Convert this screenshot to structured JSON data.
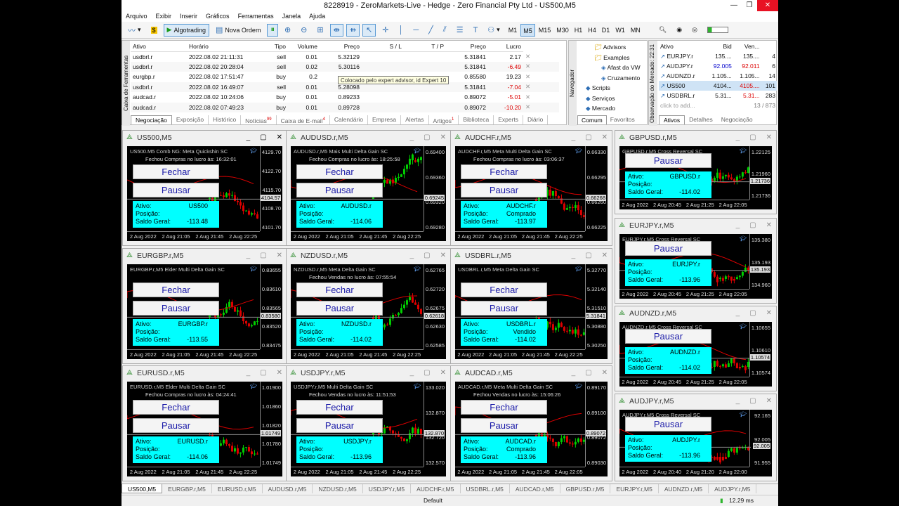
{
  "title": "8228919 - ZeroMarkets-Live - Hedge - Zero Financial Pty Ltd - US500,M5",
  "menu": [
    "Arquivo",
    "Exibir",
    "Inserir",
    "Gráficos",
    "Ferramentas",
    "Janela",
    "Ajuda"
  ],
  "toolbar": {
    "algo_label": "Algotrading",
    "new_order_label": "Nova Ordem",
    "timeframes": [
      "M1",
      "M5",
      "M15",
      "M30",
      "H1",
      "H4",
      "D1",
      "W1",
      "MN"
    ],
    "active_tf": "M5"
  },
  "toolbox": {
    "side_label": "Caixa de Ferramentas",
    "headers": [
      "Ativo",
      "Horário",
      "Tipo",
      "Volume",
      "Preço",
      "S / L",
      "T / P",
      "Preço",
      "Lucro"
    ],
    "rows": [
      {
        "symbol": "usdbrl.r",
        "time": "2022.08.02 21:11:31",
        "type": "sell",
        "volume": "0.01",
        "price": "5.32129",
        "sl": "",
        "tp": "",
        "cur": "5.31841",
        "profit": "2.17",
        "neg": false
      },
      {
        "symbol": "usdbrl.r",
        "time": "2022.08.02 20:28:04",
        "type": "sell",
        "volume": "0.02",
        "price": "5.30116",
        "sl": "",
        "tp": "",
        "cur": "5.31841",
        "profit": "-6.49",
        "neg": true
      },
      {
        "symbol": "eurgbp.r",
        "time": "2022.08.02 17:51:47",
        "type": "buy",
        "volume": "0.2",
        "price": "",
        "sl": "",
        "tp": "",
        "cur": "0.85580",
        "profit": "19.23",
        "neg": false
      },
      {
        "symbol": "usdbrl.r",
        "time": "2022.08.02 16:49:07",
        "type": "sell",
        "volume": "0.01",
        "price": "5.28098",
        "sl": "",
        "tp": "",
        "cur": "5.31841",
        "profit": "-7.04",
        "neg": true
      },
      {
        "symbol": "audcad.r",
        "time": "2022.08.02 10:24:06",
        "type": "buy",
        "volume": "0.01",
        "price": "0.89233",
        "sl": "",
        "tp": "",
        "cur": "0.89072",
        "profit": "-5.01",
        "neg": true
      },
      {
        "symbol": "audcad.r",
        "time": "2022.08.02 07:49:23",
        "type": "buy",
        "volume": "0.01",
        "price": "0.89728",
        "sl": "",
        "tp": "",
        "cur": "0.89072",
        "profit": "-10.20",
        "neg": true
      }
    ],
    "tooltip": "Colocado pelo expert advisor, id Expert 10",
    "tabs": [
      "Negociação",
      "Exposição",
      "Histórico",
      "Notícias",
      "Caixa de E-mail",
      "Calendário",
      "Empresa",
      "Alertas",
      "Artigos",
      "Biblioteca",
      "Experts",
      "Diário"
    ],
    "tab_badges": {
      "Notícias": "99",
      "Caixa de E-mail": "4",
      "Artigos": "1"
    }
  },
  "navigator": {
    "side_label": "Navegador",
    "items": [
      "Advisors",
      "Examples",
      "Afast da VW",
      "Cruzamento",
      "Scripts",
      "Serviços",
      "Mercado"
    ],
    "tabs": [
      "Comum",
      "Favoritos"
    ]
  },
  "market_watch": {
    "side_label": "Observação do Mercado: 22:31",
    "headers": [
      "Ativo",
      "Bid",
      "Ven...",
      ""
    ],
    "rows": [
      {
        "symbol": "EURJPY.r",
        "bid": "135....",
        "ask": "135....",
        "spread": "4",
        "bidc": "",
        "askc": ""
      },
      {
        "symbol": "AUDJPY.r",
        "bid": "92.005",
        "ask": "92.011",
        "spread": "6",
        "bidc": "blue",
        "askc": "red"
      },
      {
        "symbol": "AUDNZD.r",
        "bid": "1.105...",
        "ask": "1.105...",
        "spread": "14",
        "bidc": "",
        "askc": ""
      },
      {
        "symbol": "US500",
        "bid": "4104...",
        "ask": "4105....",
        "spread": "101",
        "bidc": "",
        "askc": "red",
        "sel": true
      },
      {
        "symbol": "USDBRL.r",
        "bid": "5.31...",
        "ask": "5.31...",
        "spread": "283",
        "bidc": "",
        "askc": "red"
      }
    ],
    "click_to_add": "click to add...",
    "count": "13 / 873",
    "tabs": [
      "Ativos",
      "Detalhes",
      "Negociação"
    ]
  },
  "labels": {
    "close": "Fechar",
    "pause": "Pausar",
    "asset": "Ativo:",
    "position": "Posição:",
    "balance": "Saldo Geral:"
  },
  "charts": [
    {
      "title": "US500,M5",
      "symbol": "US500",
      "position": "",
      "balance": "-113.48",
      "hdr1": "US500.M5 Comb NG: Meta Quickshin SC",
      "hdr2": "Fechou Compras no lucro às: 16:32:01",
      "prices": [
        "4129.70",
        "4122.70",
        "4115.70",
        "4108.70",
        "4101.70"
      ],
      "cur": "4104.57",
      "times": [
        "2 Aug 2022",
        "2 Aug 21:05",
        "2 Aug 21:45",
        "2 Aug 22:25"
      ],
      "showClose": true
    },
    {
      "title": "AUDUSD.r,M5",
      "symbol": "AUDUSD.r",
      "position": "",
      "balance": "-114.06",
      "hdr1": "AUDUSD.r,M5 Mais Multi Delta Gain SC",
      "hdr2": "Fechou Compras no lucro às: 18:25:58",
      "prices": [
        "0.69400",
        "0.69360",
        "0.69320",
        "0.69280"
      ],
      "cur": "0.69245",
      "times": [
        "2 Aug 2022",
        "2 Aug 21:05",
        "2 Aug 21:45",
        "2 Aug 22:25"
      ],
      "showClose": true
    },
    {
      "title": "AUDCHF.r,M5",
      "symbol": "AUDCHF.r",
      "position": "Comprado",
      "balance": "-113.97",
      "hdr1": "AUDCHF.r,M5 Meta Multi Delta Gain SC",
      "hdr2": "Fechou Compras no lucro às: 03:06:37",
      "prices": [
        "0.66330",
        "0.66295",
        "0.66260",
        "0.66225"
      ],
      "cur": "0.66268",
      "times": [
        "2 Aug 2022",
        "2 Aug 21:05",
        "2 Aug 21:45",
        "2 Aug 22:25"
      ],
      "showClose": true
    },
    {
      "title": "GBPUSD.r,M5",
      "symbol": "GBPUSD.r",
      "position": "",
      "balance": "-114.02",
      "hdr1": "GBPUSD.r,M5 Cross Reversal SC",
      "hdr2": "",
      "prices": [
        "1.22125",
        "1.21960",
        "1.21736"
      ],
      "cur": "1.21736",
      "times": [
        "2 Aug 2022",
        "2 Aug 20:45",
        "2 Aug 21:25",
        "2 Aug 22:05"
      ],
      "showClose": false
    },
    {
      "title": "EURGBP.r,M5",
      "symbol": "EURGBP.r",
      "position": "",
      "balance": "-113.55",
      "hdr1": "EURGBP.r,M5 Elder Multi Delta Gain SC",
      "hdr2": "",
      "prices": [
        "0.83655",
        "0.83610",
        "0.83565",
        "0.83520",
        "0.83475"
      ],
      "cur": "0.83580",
      "times": [
        "2 Aug 2022",
        "2 Aug 21:05",
        "2 Aug 21:45",
        "2 Aug 22:25"
      ],
      "showClose": true
    },
    {
      "title": "NZDUSD.r,M5",
      "symbol": "NZDUSD.r",
      "position": "",
      "balance": "-114.02",
      "hdr1": "NZDUSD.r,M5 Meta Delta Gain SC",
      "hdr2": "Fechou Vendas no lucro às: 07:55:54",
      "prices": [
        "0.62765",
        "0.62720",
        "0.62675",
        "0.62630",
        "0.62585"
      ],
      "cur": "0.62618",
      "times": [
        "2 Aug 2022",
        "2 Aug 21:05",
        "2 Aug 21:45",
        "2 Aug 22:25"
      ],
      "showClose": true
    },
    {
      "title": "USDBRL.r,M5",
      "symbol": "USDBRL.r",
      "position": "Vendido",
      "balance": "-114.02",
      "hdr1": "USDBRL.r,M5 Meta Delta Gain SC",
      "hdr2": "",
      "prices": [
        "5.32770",
        "5.32140",
        "5.31510",
        "5.30880",
        "5.30250"
      ],
      "cur": "5.31841",
      "times": [
        "2 Aug 2022",
        "2 Aug 21:05",
        "2 Aug 21:45",
        "2 Aug 22:25"
      ],
      "showClose": true
    },
    {
      "title": "EURJPY.r,M5",
      "symbol": "EURJPY.r",
      "position": "",
      "balance": "-113.96",
      "hdr1": "EURJPY.r,M5 Cross Reversal SC",
      "hdr2": "",
      "prices": [
        "135.380",
        "135.193",
        "134.960"
      ],
      "cur": "135.193",
      "times": [
        "2 Aug 2022",
        "2 Aug 20:45",
        "2 Aug 21:25",
        "2 Aug 22:05"
      ],
      "showClose": false
    },
    {
      "title": "AUDNZD.r,M5",
      "symbol": "AUDNZD.r",
      "position": "",
      "balance": "-114.02",
      "hdr1": "AUDNZD.r,M5 Cross Reversal SC",
      "hdr2": "",
      "prices": [
        "1.10655",
        "1.10610",
        "1.10574"
      ],
      "cur": "1.10574",
      "times": [
        "2 Aug 2022",
        "2 Aug 20:45",
        "2 Aug 21:25",
        "2 Aug 22:05"
      ],
      "showClose": false
    },
    {
      "title": "EURUSD.r,M5",
      "symbol": "EURUSD.r",
      "position": "",
      "balance": "-114.06",
      "hdr1": "EURUSD.r,M5 Elder Multi Delta Gain SC",
      "hdr2": "Fechou Compras no lucro às: 04:24:41",
      "prices": [
        "1.01900",
        "1.01860",
        "1.01820",
        "1.01780",
        "1.01749"
      ],
      "cur": "1.01749",
      "times": [
        "2 Aug 2022",
        "2 Aug 21:05",
        "2 Aug 21:45",
        "2 Aug 22:25"
      ],
      "showClose": true
    },
    {
      "title": "USDJPY.r,M5",
      "symbol": "USDJPY.r",
      "position": "",
      "balance": "-113.96",
      "hdr1": "USDJPY.r,M5 Multi Delta Gain SC",
      "hdr2": "Fechou Vendas no lucro às: 11:51:53",
      "prices": [
        "133.020",
        "132.870",
        "132.720",
        "132.570"
      ],
      "cur": "132.870",
      "times": [
        "2 Aug 2022",
        "2 Aug 21:05",
        "2 Aug 21:45",
        "2 Aug 22:25"
      ],
      "showClose": true
    },
    {
      "title": "AUDCAD.r,M5",
      "symbol": "AUDCAD.r",
      "position": "Comprado",
      "balance": "-113.96",
      "hdr1": "AUDCAD.r,M5 Meta Multi Delta Gain SC",
      "hdr2": "Fechou Vendas no lucro às: 15:06:26",
      "prices": [
        "0.89170",
        "0.89100",
        "0.89072",
        "0.89030"
      ],
      "cur": "0.89072",
      "times": [
        "2 Aug 2022",
        "2 Aug 21:05",
        "2 Aug 21:45",
        "2 Aug 22:05"
      ],
      "showClose": true
    },
    {
      "title": "AUDJPY.r,M5",
      "symbol": "AUDJPY.r",
      "position": "",
      "balance": "-113.96",
      "hdr1": "AUDJPY.r,M5 Cross Reversal SC",
      "hdr2": "",
      "prices": [
        "92.165",
        "92.005",
        "91.955"
      ],
      "cur": "92.005",
      "times": [
        "2 Aug 2022",
        "2 Aug 20:40",
        "2 Aug 21:20",
        "2 Aug 22:00"
      ],
      "showClose": false
    }
  ],
  "bottom_tabs": [
    "US500,M5",
    "EURGBP.r,M5",
    "EURUSD.r,M5",
    "AUDUSD.r,M5",
    "NZDUSD.r,M5",
    "USDJPY.r,M5",
    "AUDCHF.r,M5",
    "USDBRL.r,M5",
    "AUDCAD.r,M5",
    "GBPUSD.r,M5",
    "EURJPY.r,M5",
    "AUDNZD.r,M5",
    "AUDJPY.r,M5"
  ],
  "status": {
    "profile": "Default",
    "ping": "12.29 ms"
  },
  "colors": {
    "info_bg": "#00ffff",
    "button_text": "#1a1aa8",
    "bull": "#00d000",
    "bear": "#e00000",
    "chart_bg": "#000000"
  }
}
